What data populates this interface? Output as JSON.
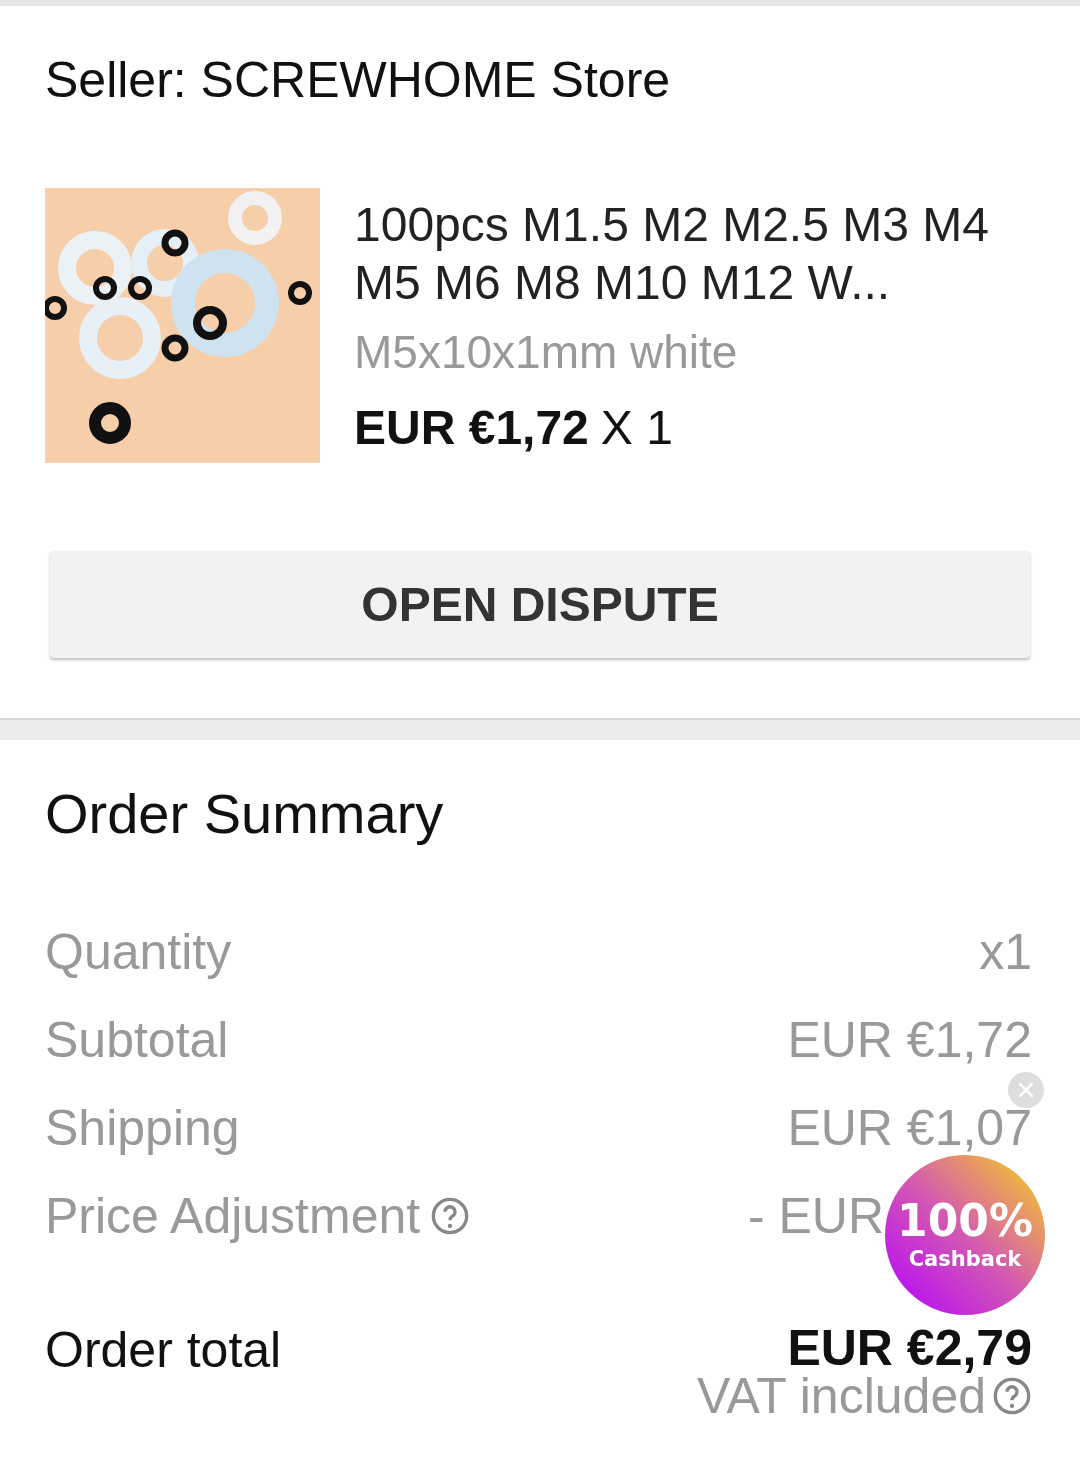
{
  "seller": {
    "label": "Seller: SCREWHOME Store"
  },
  "product": {
    "title": "100pcs M1.5 M2 M2.5 M3 M4 M5 M6 M8 M10 M12 W...",
    "variant": "M5x10x1mm white",
    "price": "EUR €1,72",
    "quantity": "X 1"
  },
  "dispute_button": "OPEN DISPUTE",
  "order_summary": {
    "title": "Order Summary",
    "rows": [
      {
        "label": "Quantity",
        "value": "x1",
        "help": false
      },
      {
        "label": "Subtotal",
        "value": "EUR €1,72",
        "help": false
      },
      {
        "label": "Shipping",
        "value": "EUR €1,07",
        "help": false
      },
      {
        "label": "Price Adjustment",
        "value": "- EUR",
        "help": true
      }
    ],
    "total_label": "Order total",
    "total_value": "EUR €2,79",
    "vat_note": "VAT included"
  },
  "cashback_badge": {
    "percent": "100%",
    "label": "Cashback"
  }
}
